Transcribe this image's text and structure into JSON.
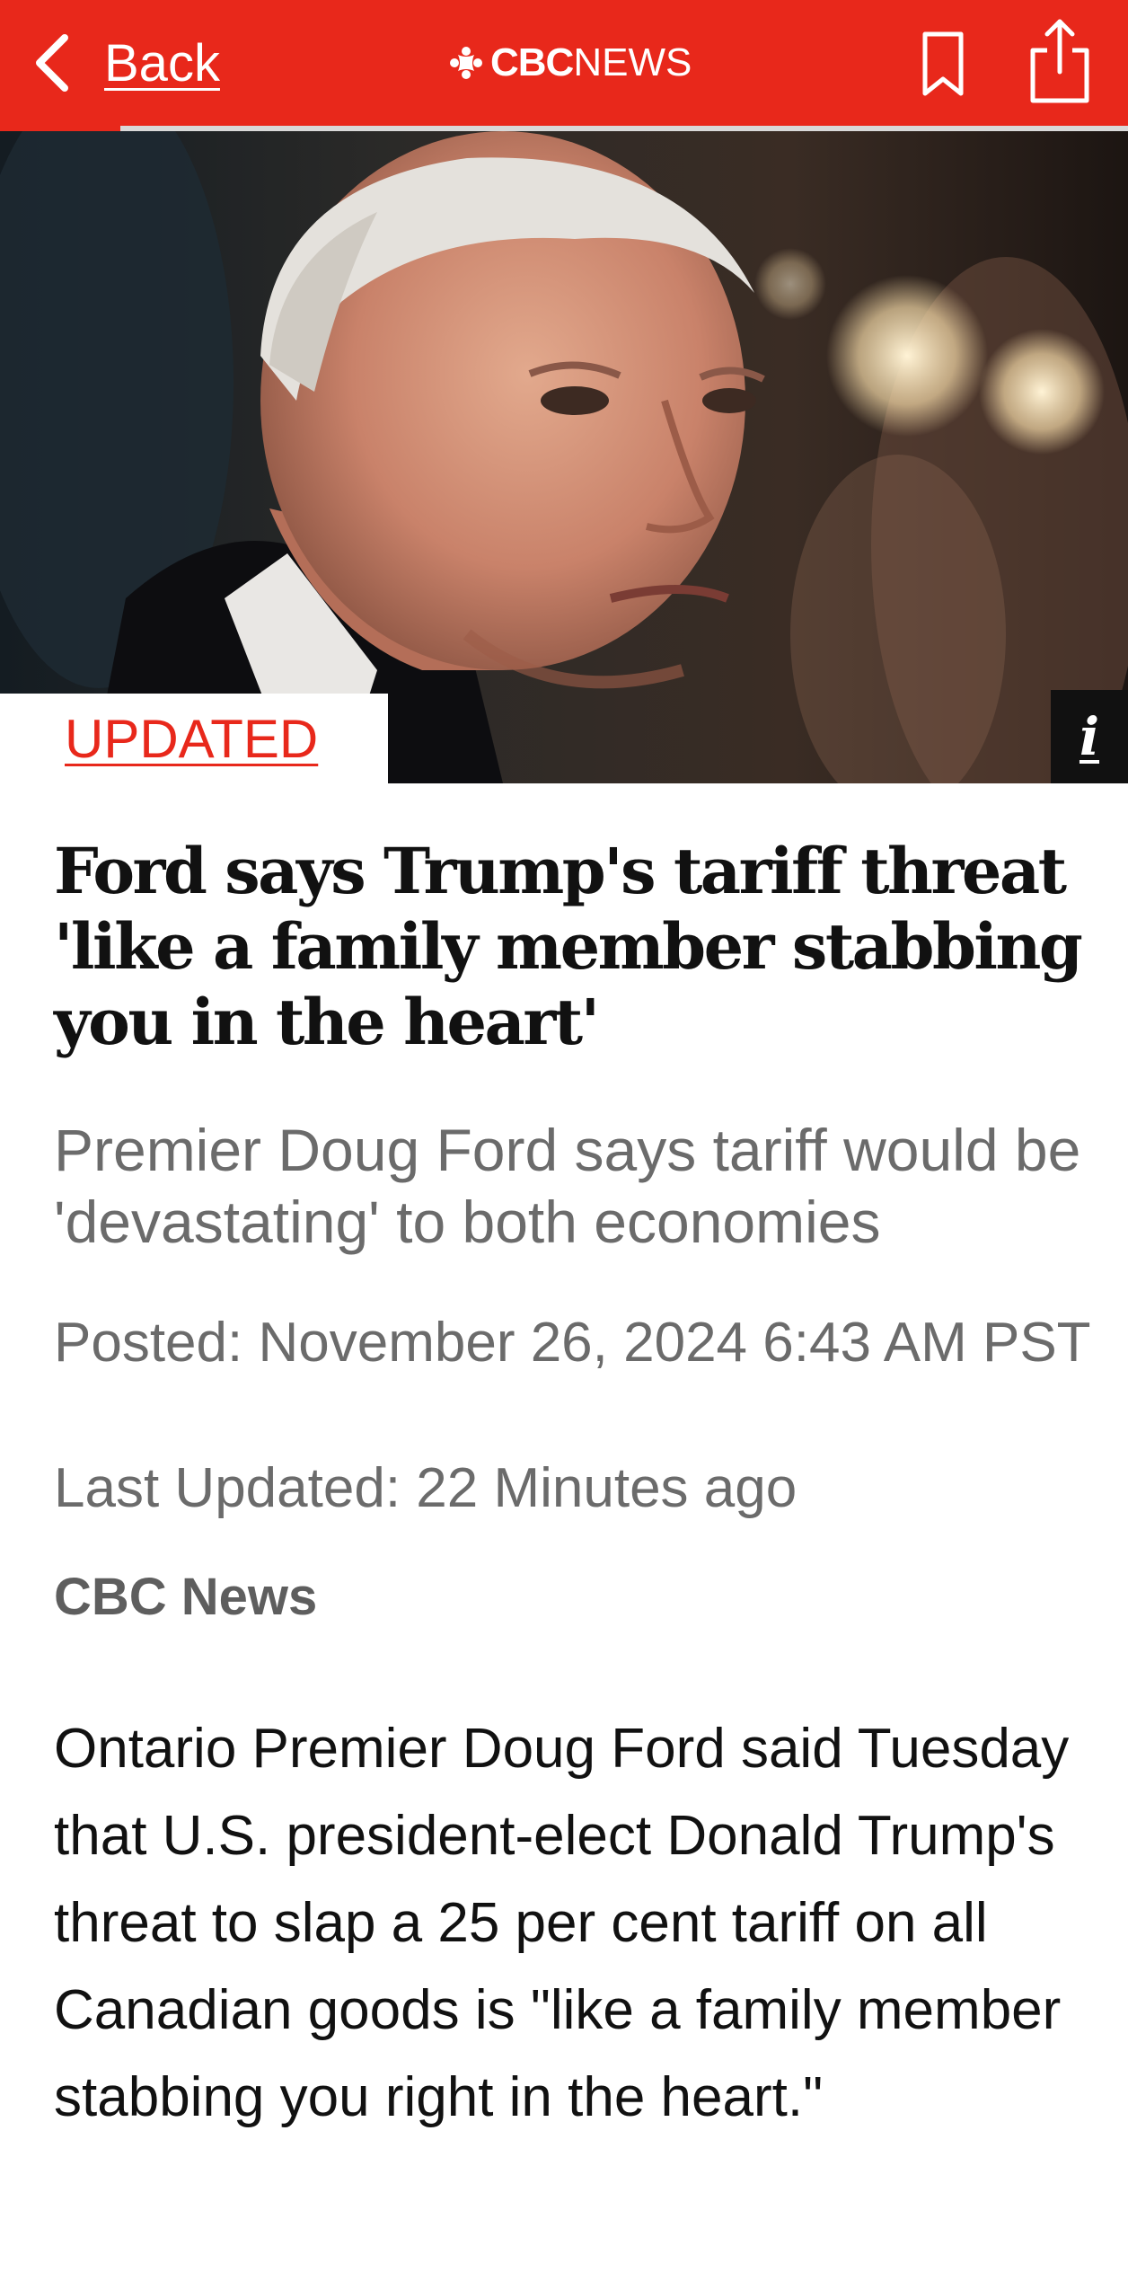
{
  "nav": {
    "back_label": "Back",
    "brand_cbc": "CBC",
    "brand_news": "NEWS",
    "bookmark_icon": "bookmark-icon",
    "share_icon": "share-icon",
    "accent_color": "#e8281b",
    "reading_progress": 0.107
  },
  "hero": {
    "status_tag": "UPDATED",
    "info_glyph": "i"
  },
  "article": {
    "headline": "Ford says Trump's tariff threat 'like a family member stabbing you in the heart'",
    "subheadline": "Premier Doug Ford says tariff would be 'devastating' to both economies",
    "posted": "Posted: November 26, 2024 6:43 AM PST",
    "last_updated": "Last Updated: 22 Minutes ago",
    "byline": "CBC News",
    "body_paragraph_1": "Ontario Premier Doug Ford said Tuesday that U.S. president-elect Donald Trump's threat to slap a 25 per cent tariff on all Canadian goods is \"like a family member stabbing you right in the heart.\""
  }
}
